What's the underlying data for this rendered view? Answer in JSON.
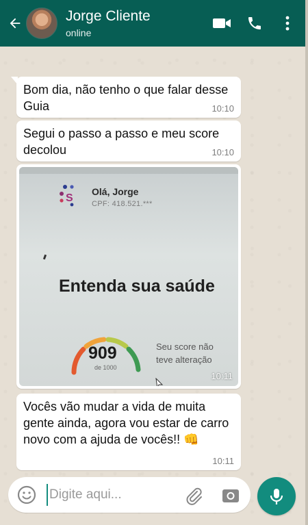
{
  "header": {
    "contact_name": "Jorge Cliente",
    "status": "online",
    "icons": [
      "back-arrow-icon",
      "video-call-icon",
      "phone-call-icon",
      "more-options-icon"
    ]
  },
  "messages": [
    {
      "text": "Bom dia, não tenho o que falar desse Guia",
      "time": "10:10"
    },
    {
      "text": "Segui o passo a passo e meu score decolou",
      "time": "10:10"
    },
    {
      "type": "image",
      "time": "10:11",
      "photo": {
        "logo_letter": "S",
        "greeting": "Olá, Jorge",
        "cpf": "CPF: 418.521.***",
        "heading": "Entenda sua saúde",
        "score": "909",
        "score_max": "de 1000",
        "note": "Seu score não teve alteração"
      }
    },
    {
      "text": "Vocês vão mudar a vida de muita gente ainda, agora vou estar de carro novo com a ajuda de vocês!! 👊",
      "time": "10:11"
    }
  ],
  "composer": {
    "placeholder": "Digite aqui...",
    "icons": [
      "emoji-icon",
      "attach-icon",
      "camera-icon",
      "mic-icon"
    ]
  },
  "colors": {
    "header": "#075e54",
    "accent": "#128c7e",
    "bubble": "#ffffff",
    "wallpaper": "#e6dfd4"
  }
}
